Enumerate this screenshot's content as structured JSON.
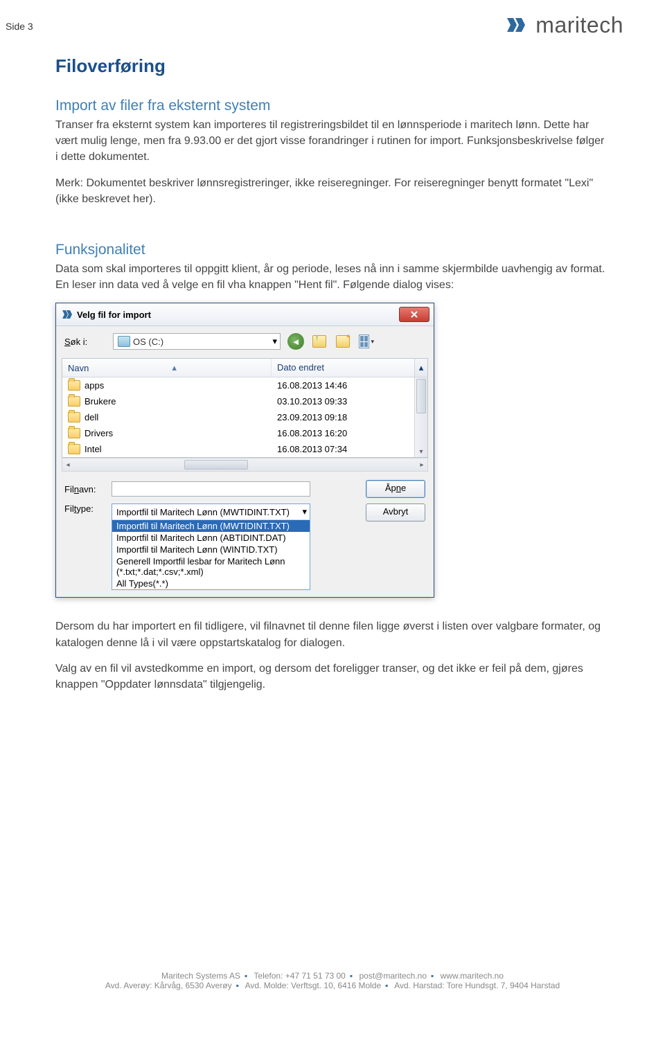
{
  "page_label": "Side 3",
  "logo_text": "maritech",
  "h1": "Filoverføring",
  "h2_import": "Import av filer fra eksternt system",
  "p_import_1": "Transer fra eksternt system kan importeres til registreringsbildet til en lønnsperiode i maritech lønn. Dette har vært mulig lenge, men fra 9.93.00 er det gjort visse forandringer i rutinen for import. Funksjonsbeskrivelse følger i dette dokumentet.",
  "p_import_2": "Merk: Dokumentet beskriver lønnsregistreringer, ikke reiseregninger. For reiseregninger benytt formatet \"Lexi\" (ikke beskrevet her).",
  "h2_funk": "Funksjonalitet",
  "p_funk_1": "Data som skal importeres til oppgitt klient, år og periode, leses nå inn i samme skjermbilde uavhengig av format. En leser inn data ved å velge en fil vha knappen \"Hent fil\". Følgende dialog vises:",
  "dialog": {
    "title": "Velg fil for import",
    "search_label": "Søk i:",
    "drive": "OS (C:)",
    "col_name": "Navn",
    "col_date": "Dato endret",
    "rows": [
      {
        "name": "apps",
        "date": "16.08.2013 14:46"
      },
      {
        "name": "Brukere",
        "date": "03.10.2013 09:33"
      },
      {
        "name": "dell",
        "date": "23.09.2013 09:18"
      },
      {
        "name": "Drivers",
        "date": "16.08.2013 16:20"
      },
      {
        "name": "Intel",
        "date": "16.08.2013 07:34"
      }
    ],
    "filename_label": "Filnavn:",
    "filetype_label": "Filtype:",
    "filetype_selected": "Importfil til Maritech Lønn (MWTIDINT.TXT)",
    "filetype_options": [
      "Importfil til Maritech Lønn (MWTIDINT.TXT)",
      "Importfil til Maritech Lønn (ABTIDINT.DAT)",
      "Importfil til Maritech Lønn (WINTID.TXT)",
      "Generell Importfil lesbar for Maritech Lønn (*.txt;*.dat;*.csv;*.xml)",
      "All Types(*.*)"
    ],
    "open_btn": "Åpne",
    "cancel_btn": "Avbryt"
  },
  "p_after_1": "Dersom du har importert en fil tidligere, vil filnavnet til denne filen ligge øverst i listen over valgbare formater, og katalogen denne lå i vil være oppstartskatalog for dialogen.",
  "p_after_2": "Valg av en fil vil avstedkomme en import, og dersom det foreligger transer, og det ikke er feil på dem, gjøres knappen \"Oppdater lønnsdata\" tilgjengelig.",
  "footer": {
    "line1_a": "Maritech Systems AS",
    "line1_b": "Telefon: +47 71 51 73 00",
    "line1_c": "post@maritech.no",
    "line1_d": "www.maritech.no",
    "line2_a": "Avd. Averøy: Kårvåg, 6530 Averøy",
    "line2_b": "Avd. Molde: Verftsgt. 10, 6416 Molde",
    "line2_c": "Avd. Harstad: Tore Hundsgt. 7, 9404 Harstad"
  }
}
